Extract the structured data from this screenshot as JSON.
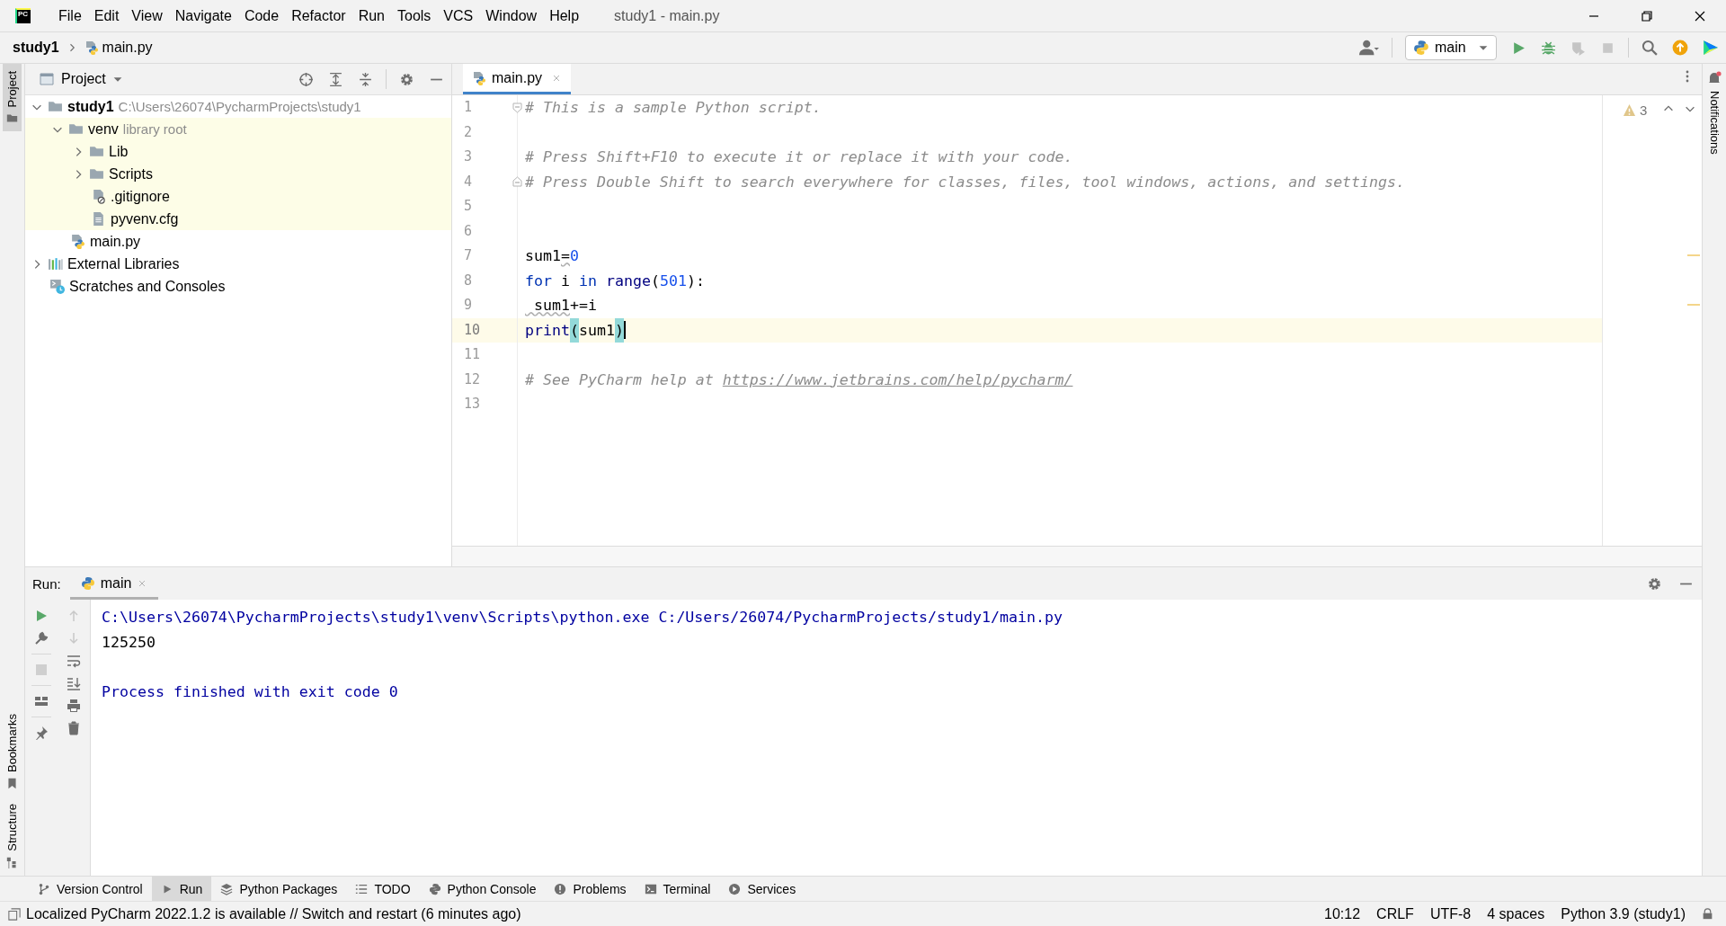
{
  "window": {
    "logo": "PC",
    "title": "study1 - main.py"
  },
  "menu": [
    "File",
    "Edit",
    "View",
    "Navigate",
    "Code",
    "Refactor",
    "Run",
    "Tools",
    "VCS",
    "Window",
    "Help"
  ],
  "breadcrumb": [
    "study1",
    "main.py"
  ],
  "run_configuration": "main",
  "left_strip": {
    "top": [
      {
        "label": "Project",
        "selected": true
      }
    ],
    "bottom": [
      {
        "label": "Bookmarks",
        "selected": false
      },
      {
        "label": "Structure",
        "selected": false
      }
    ]
  },
  "right_strip": [
    {
      "label": "Notifications",
      "selected": false
    }
  ],
  "project_panel": {
    "title": "Project",
    "tree": [
      {
        "label": "study1",
        "kind": "project",
        "hint": "C:\\Users\\26074\\PycharmProjects\\study1",
        "expanded": true,
        "children": [
          {
            "label": "venv",
            "kind": "folder",
            "hint": "library root",
            "library": true,
            "expanded": true,
            "children": [
              {
                "label": "Lib",
                "kind": "folder",
                "expanded": false
              },
              {
                "label": "Scripts",
                "kind": "folder",
                "expanded": false
              },
              {
                "label": ".gitignore",
                "kind": "ignore-file"
              },
              {
                "label": "pyvenv.cfg",
                "kind": "text-file"
              }
            ]
          },
          {
            "label": "main.py",
            "kind": "python-file"
          }
        ]
      },
      {
        "label": "External Libraries",
        "kind": "libraries",
        "expanded": false
      },
      {
        "label": "Scratches and Consoles",
        "kind": "scratches"
      }
    ]
  },
  "editor": {
    "tabs": [
      {
        "label": "main.py",
        "selected": true
      }
    ],
    "warnings": "3",
    "lines": [
      {
        "number": "1",
        "current": false,
        "fold_start": true,
        "tokens": [
          {
            "kind": "comment",
            "text": "# This is a sample Python script."
          }
        ]
      },
      {
        "number": "2",
        "current": false
      },
      {
        "number": "3",
        "current": false,
        "tokens": [
          {
            "kind": "comment",
            "text": "# Press Shift+F10 to execute it or replace it with your code."
          }
        ]
      },
      {
        "number": "4",
        "current": false,
        "fold_end": true,
        "tokens": [
          {
            "kind": "comment",
            "text": "# Press Double Shift to search everywhere for classes, files, tool windows, actions, and settings."
          }
        ]
      },
      {
        "number": "5",
        "current": false
      },
      {
        "number": "6",
        "current": false
      },
      {
        "number": "7",
        "current": false,
        "tokens": [
          {
            "kind": "plain",
            "text": "sum1"
          },
          {
            "kind": "warned",
            "text": "="
          },
          {
            "kind": "number",
            "text": "0"
          }
        ]
      },
      {
        "number": "8",
        "current": false,
        "tokens": [
          {
            "kind": "keyword",
            "text": "for"
          },
          {
            "kind": "plain",
            "text": " i "
          },
          {
            "kind": "keyword",
            "text": "in"
          },
          {
            "kind": "builtin",
            "text": " range"
          },
          {
            "kind": "plain",
            "text": "("
          },
          {
            "kind": "number",
            "text": "501"
          },
          {
            "kind": "plain",
            "text": "):"
          }
        ]
      },
      {
        "number": "9",
        "current": false,
        "tokens": [
          {
            "kind": "warned",
            "text": " sum1"
          },
          {
            "kind": "plain",
            "text": "+=i"
          }
        ]
      },
      {
        "number": "10",
        "current": true,
        "caret": true,
        "tokens": [
          {
            "kind": "builtin",
            "text": "print"
          },
          {
            "kind": "brace",
            "text": "("
          },
          {
            "kind": "plain",
            "text": "sum1"
          },
          {
            "kind": "brace",
            "text": ")"
          }
        ]
      },
      {
        "number": "11",
        "current": false
      },
      {
        "number": "12",
        "current": false,
        "tokens": [
          {
            "kind": "comment",
            "text": "# See PyCharm help at "
          },
          {
            "kind": "link",
            "text": "https://www.jetbrains.com/help/pycharm/"
          }
        ]
      },
      {
        "number": "13",
        "current": false
      }
    ]
  },
  "run_panel": {
    "title": "Run:",
    "tabs": [
      {
        "label": "main",
        "selected": true
      }
    ],
    "output": [
      {
        "kind": "system",
        "text": "C:\\Users\\26074\\PycharmProjects\\study1\\venv\\Scripts\\python.exe C:/Users/26074/PycharmProjects/study1/main.py"
      },
      {
        "kind": "stdout",
        "text": "125250"
      },
      {
        "kind": "exit",
        "text": "Process finished with exit code 0"
      }
    ]
  },
  "tool_tabs": [
    {
      "label": "Version Control",
      "kind": "vcs",
      "selected": false
    },
    {
      "label": "Run",
      "kind": "run",
      "selected": true
    },
    {
      "label": "Python Packages",
      "kind": "packages",
      "selected": false
    },
    {
      "label": "TODO",
      "kind": "todo",
      "selected": false
    },
    {
      "label": "Python Console",
      "kind": "console",
      "selected": false
    },
    {
      "label": "Problems",
      "kind": "problems",
      "selected": false
    },
    {
      "label": "Terminal",
      "kind": "terminal",
      "selected": false
    },
    {
      "label": "Services",
      "kind": "services",
      "selected": false
    }
  ],
  "status_bar": {
    "message": "Localized PyCharm 2022.1.2 is available // Switch and restart (6 minutes ago)",
    "items": [
      "10:12",
      "CRLF",
      "UTF-8",
      "4 spaces",
      "Python 3.9 (study1)"
    ]
  }
}
